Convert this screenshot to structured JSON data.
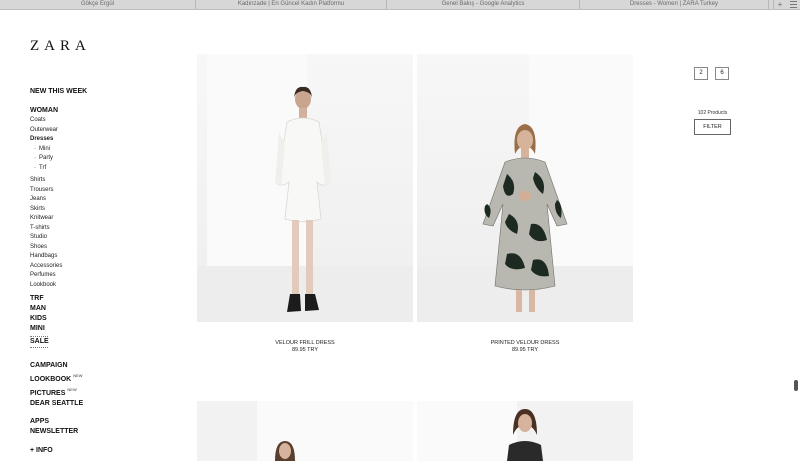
{
  "browser": {
    "tabs": [
      "Gökçe Ergül",
      "Kadınzade | En Güncel Kadın Platformu",
      "Genel Bakış - Google Analytics",
      "Dresses - Women | ZARA Turkey"
    ],
    "new_tab": "+"
  },
  "logo": "ZARA",
  "sidebar": {
    "new_this_week": "NEW THIS WEEK",
    "woman": "WOMAN",
    "woman_items": [
      "Coats",
      "Outerwear"
    ],
    "dresses": "Dresses",
    "dresses_sub": [
      "Mini",
      "Party",
      "Trf"
    ],
    "woman_items2": [
      "Shirts",
      "Trousers",
      "Jeans",
      "Skirts",
      "Knitwear",
      "T-shirts",
      "Studio",
      "Shoes",
      "Handbags",
      "Accessories",
      "Perfumes",
      "Lookbook"
    ],
    "sections": [
      "TRF",
      "MAN",
      "KIDS",
      "MINI"
    ],
    "sale": "SALE",
    "campaign": "CAMPAIGN",
    "lookbook": "LOOKBOOK",
    "lookbook_badge": "NEW",
    "pictures": "PICTURES",
    "pictures_badge": "NEW",
    "dear_seattle": "DEAR SEATTLE",
    "apps": "APPS",
    "newsletter": "NEWSLETTER",
    "more_info": "+ INFO"
  },
  "products": [
    {
      "name": "VELOUR FRILL DRESS",
      "price": "89.95 TRY"
    },
    {
      "name": "PRINTED VELOUR DRESS",
      "price": "89.95 TRY"
    }
  ],
  "controls": {
    "view_2": "2",
    "view_6": "6",
    "count": "102 Products",
    "filter": "FILTER"
  }
}
